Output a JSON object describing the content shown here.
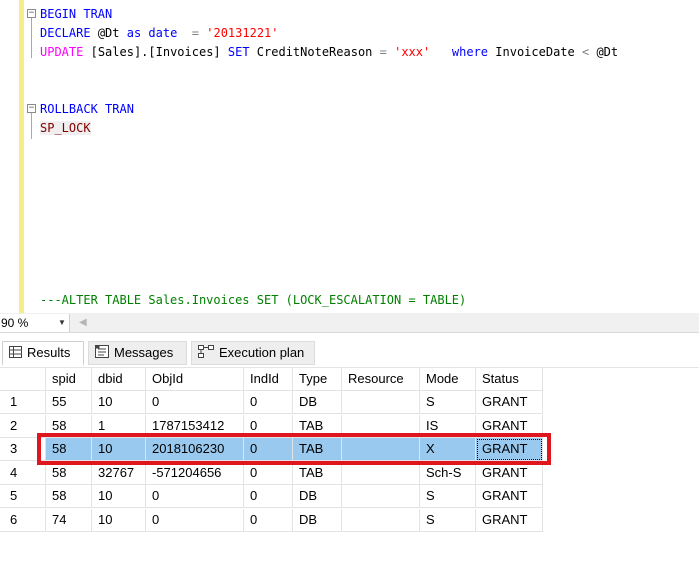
{
  "editor": {
    "line1": {
      "kw1": "BEGIN",
      "kw2": "TRAN"
    },
    "line2": {
      "declare": "DECLARE",
      "var": "@Dt",
      "as": "as",
      "type": "date",
      "eq": "=",
      "value": "'20131221'"
    },
    "line3": {
      "update": "UPDATE",
      "table": "[Sales].[Invoices]",
      "set": "SET",
      "col": "CreditNoteReason",
      "eq": "=",
      "value": "'xxx'",
      "where": "where",
      "col2": "InvoiceDate",
      "op": "<",
      "var": "@Dt"
    },
    "line4": {
      "kw1": "ROLLBACK",
      "kw2": "TRAN"
    },
    "line5": {
      "proc": "SP_LOCK"
    },
    "line6": {
      "comment": "---ALTER TABLE Sales.Invoices SET (LOCK_ESCALATION = TABLE)"
    }
  },
  "zoom": {
    "value": "90 %",
    "arrow_icon": "chevron-down-icon"
  },
  "tabs": [
    {
      "label": "Results",
      "icon": "grid-icon",
      "active": true
    },
    {
      "label": "Messages",
      "icon": "messages-icon",
      "active": false
    },
    {
      "label": "Execution plan",
      "icon": "execution-plan-icon",
      "active": false
    }
  ],
  "grid": {
    "columns": [
      "spid",
      "dbid",
      "ObjId",
      "IndId",
      "Type",
      "Resource",
      "Mode",
      "Status"
    ],
    "rows": [
      {
        "n": "1",
        "spid": "55",
        "dbid": "10",
        "ObjId": "0",
        "IndId": "0",
        "Type": "DB",
        "Resource": "",
        "Mode": "S",
        "Status": "GRANT"
      },
      {
        "n": "2",
        "spid": "58",
        "dbid": "1",
        "ObjId": "1787153412",
        "IndId": "0",
        "Type": "TAB",
        "Resource": "",
        "Mode": "IS",
        "Status": "GRANT"
      },
      {
        "n": "3",
        "spid": "58",
        "dbid": "10",
        "ObjId": "2018106230",
        "IndId": "0",
        "Type": "TAB",
        "Resource": "",
        "Mode": "X",
        "Status": "GRANT"
      },
      {
        "n": "4",
        "spid": "58",
        "dbid": "32767",
        "ObjId": "-571204656",
        "IndId": "0",
        "Type": "TAB",
        "Resource": "",
        "Mode": "Sch-S",
        "Status": "GRANT"
      },
      {
        "n": "5",
        "spid": "58",
        "dbid": "10",
        "ObjId": "0",
        "IndId": "0",
        "Type": "DB",
        "Resource": "",
        "Mode": "S",
        "Status": "GRANT"
      },
      {
        "n": "6",
        "spid": "74",
        "dbid": "10",
        "ObjId": "0",
        "IndId": "0",
        "Type": "DB",
        "Resource": "",
        "Mode": "S",
        "Status": "GRANT"
      }
    ],
    "selected_row": 3
  },
  "colors": {
    "selection": "#99c9ef",
    "highlight_border": "#e0161e",
    "keyword": "#0000ff",
    "string": "#ff0000",
    "function": "#ff00ff",
    "comment": "#008000"
  }
}
